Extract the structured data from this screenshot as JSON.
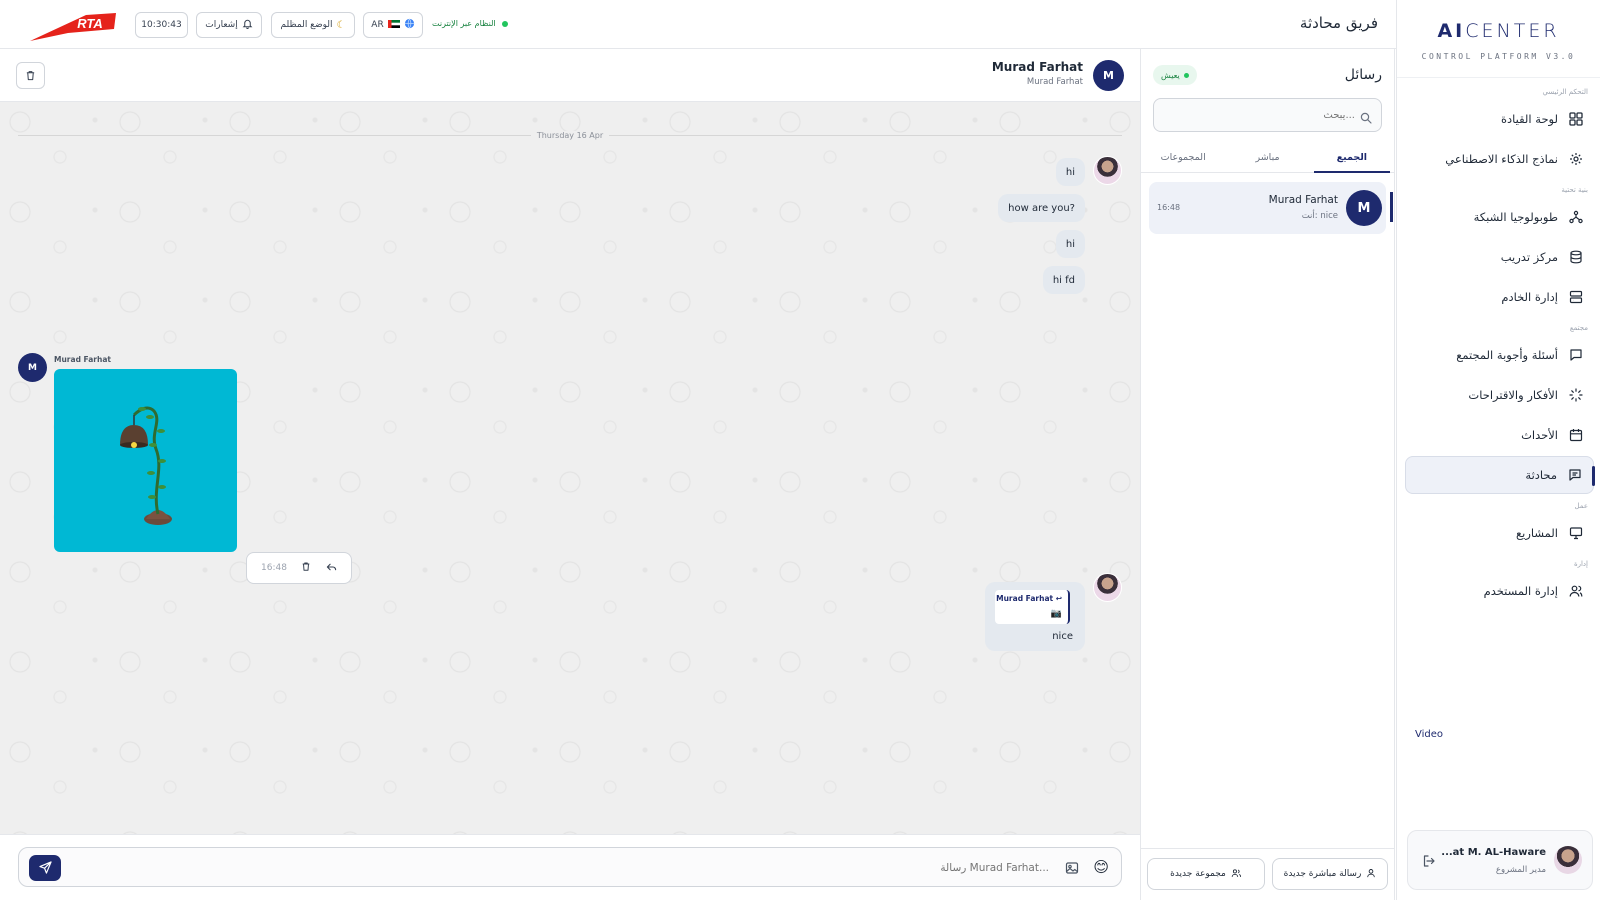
{
  "brand": {
    "name_bold": "AI",
    "name_rest": "CENTER",
    "subtitle": "CONTROL PLATFORM V3.0"
  },
  "sidebar": {
    "sections": {
      "main": "التحكم الرئيسي",
      "infra": "بنية تحتية",
      "community": "مجتمع",
      "work": "عمل",
      "admin": "إدارة"
    },
    "items": [
      {
        "label": "لوحة القيادة",
        "icon": "dashboard-grid-icon"
      },
      {
        "label": "نماذج الذكاء الاصطناعي",
        "icon": "ai-sparkle-icon"
      },
      {
        "label": "طوبولوجيا الشبكة",
        "icon": "network-icon"
      },
      {
        "label": "مركز تدريب",
        "icon": "database-icon"
      },
      {
        "label": "إدارة الخادم",
        "icon": "server-icon"
      },
      {
        "label": "أسئلة وأجوبة المجتمع",
        "icon": "chat-square-icon"
      },
      {
        "label": "الأفكار والاقتراحات",
        "icon": "loader-icon"
      },
      {
        "label": "الأحداث",
        "icon": "calendar-icon"
      },
      {
        "label": "محادثة",
        "icon": "message-icon",
        "active": true
      },
      {
        "label": "المشاريع",
        "icon": "monitor-icon"
      },
      {
        "label": "إدارة المستخدم",
        "icon": "users-icon"
      }
    ],
    "video_label": "Video",
    "user": {
      "name": "...at M. AL-Haware",
      "role": "مدير المشروع"
    }
  },
  "header": {
    "title": "فريق محادثة",
    "clock": "10:30:43",
    "notifications_label": "إشعارات",
    "dark_mode_label": "الوضع المظلم",
    "lang_code": "AR",
    "system_status": "النظام عبر الإنترنت",
    "logo_text": "RTA"
  },
  "conversations": {
    "title": "رسائل",
    "live_badge": "يعيش",
    "search_placeholder": "يبحث...",
    "tabs": [
      "الجميع",
      "مباشر",
      "المجموعات"
    ],
    "items": [
      {
        "initial": "M",
        "name": "Murad Farhat",
        "preview": "أنت: nice",
        "time": "16:48"
      }
    ],
    "new_dm_label": "رسالة مباشرة جديدة",
    "new_group_label": "مجموعة جديدة"
  },
  "chat": {
    "contact": {
      "initial": "M",
      "name": "Murad Farhat",
      "subtitle": "Murad Farhat"
    },
    "date_label": "Thursday 16 Apr",
    "outgoing": [
      "hi",
      "how are you?",
      "hi",
      "hi fd"
    ],
    "incoming": {
      "sender": "Murad Farhat",
      "initial": "M",
      "type": "image",
      "time": "16:48"
    },
    "reply": {
      "quote_name": "Murad Farhat ↩",
      "quote_icon": "📷",
      "text": "nice"
    },
    "composer_placeholder": "رسالة Murad Farhat...",
    "emoji": "😊"
  },
  "colors": {
    "primary": "#1e2a6e",
    "accent_red": "#e5231b",
    "online": "#22c55e",
    "image_bg": "#00b8d4"
  }
}
